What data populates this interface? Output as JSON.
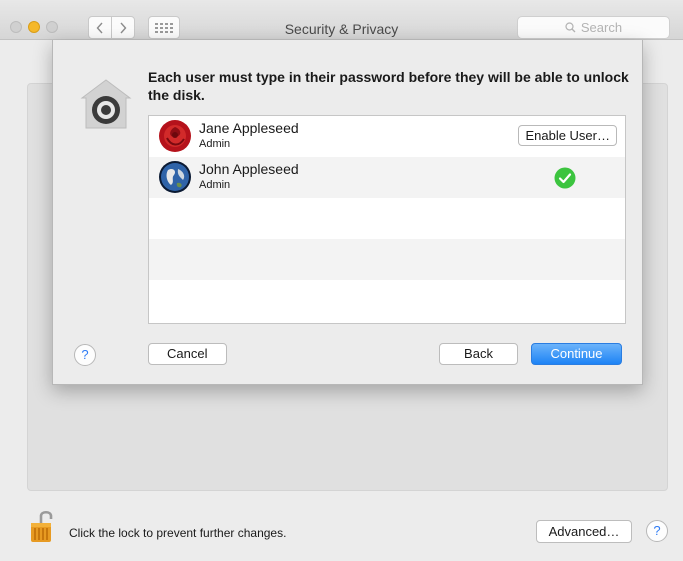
{
  "window": {
    "title": "Security & Privacy"
  },
  "search": {
    "placeholder": "Search"
  },
  "sheet": {
    "message": "Each user must type in their password before they will be able to unlock the disk.",
    "users": [
      {
        "name": "Jane Appleseed",
        "role": "Admin",
        "avatar": "rose-avatar",
        "action": "Enable User…"
      },
      {
        "name": "John Appleseed",
        "role": "Admin",
        "avatar": "earth-avatar",
        "status": "enabled"
      }
    ],
    "buttons": {
      "cancel": "Cancel",
      "back": "Back",
      "continue": "Continue",
      "help": "?"
    }
  },
  "footer": {
    "lock_text": "Click the lock to prevent further changes.",
    "advanced": "Advanced…",
    "help": "?"
  },
  "colors": {
    "accent": "#1d83f5",
    "check": "#3cc43f",
    "minimize": "#f5b82a"
  }
}
